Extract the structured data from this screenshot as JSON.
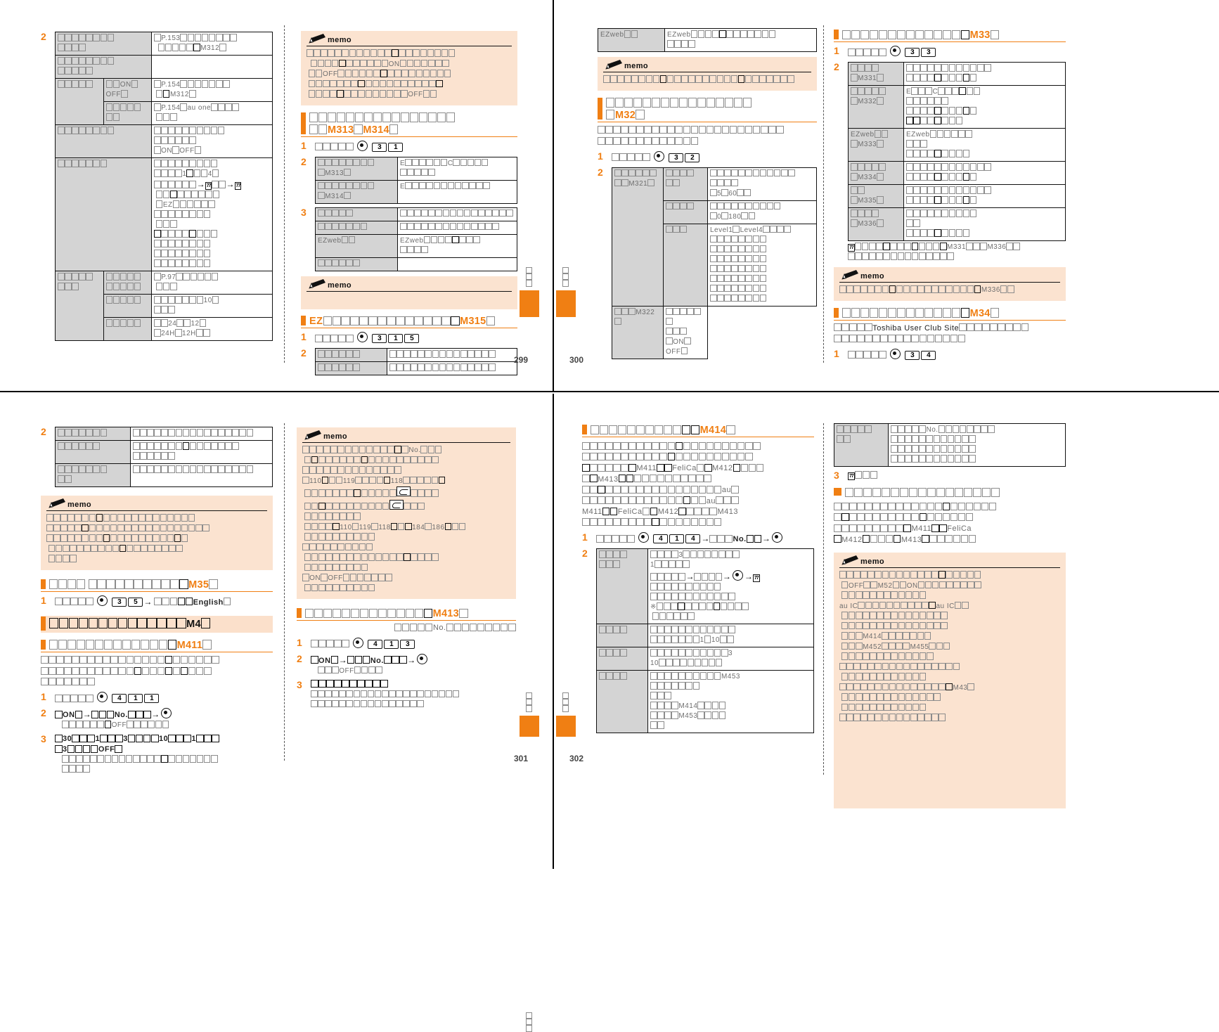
{
  "document": {
    "kind": "japanese-mobile-phone-manual-spread",
    "brand_text": [
      "au",
      "EZweb",
      "au one",
      "FeliCa",
      "Toshiba User Club Site",
      "English",
      "memo",
      "ON",
      "OFF",
      "No.",
      "Level1",
      "Level4"
    ],
    "accent_color": "#F07F13",
    "memo_bg": "#FBE3D0",
    "table_header_bg": "#D4D4D4",
    "note": "CJK glyphs render as empty boxes (tofu) in the source screenshot"
  },
  "pages": [
    {
      "number": "299",
      "position": "top-left-spread-right-column"
    },
    {
      "number": "300",
      "position": "top-right-spread-left-column"
    },
    {
      "number": "301",
      "position": "bottom-left-spread-right-column"
    },
    {
      "number": "302",
      "position": "bottom-right-spread-left-column"
    }
  ],
  "p299": {
    "left_table": {
      "step_number": "2",
      "rows": [
        {
          "c1": {
            "tofu": 8,
            "tofu2": 4
          },
          "c2": null,
          "c3_lat": "P.153",
          "c3_lat2": "M312",
          "c3_tofu": 13
        },
        {
          "c1": {
            "tofu": 9,
            "tofu2": 5
          },
          "c2": null,
          "c3_tofu": 0
        },
        {
          "c1": {
            "tofu": 6
          },
          "c2": {
            "tofu": 2,
            "lat": "ON",
            "lat2": "OFF",
            "tofu2": 1
          },
          "c3_lat": "P.154",
          "c3_lat2": "M312",
          "c3_tofu": 12
        },
        {
          "c1": null,
          "c2": {
            "tofu": 5,
            "tofu2": 2
          },
          "c3_lat": "P.154",
          "c3_lat2": "au one",
          "c3_tofu": 11
        },
        {
          "c1": {
            "tofu": 8
          },
          "c2": null,
          "c3_tofu": 14,
          "c3_lat": "ON",
          "c3_lat2": "OFF"
        },
        {
          "c1": {
            "tofu": 7
          },
          "c2": null,
          "c3_tofu": 13,
          "c3_lat": "1",
          "c3_lat2": "4",
          "c3_lat3": "EZ"
        },
        {
          "c1": {
            "tofu": 5,
            "tofu2": 3
          },
          "c2": {
            "tofu": 5,
            "tofu2": 5
          },
          "c3_lat": "P.97",
          "c3_tofu": 13
        },
        {
          "c1": null,
          "c2": {
            "tofu": 5
          },
          "c3_lat": "10",
          "c3_tofu": 12
        },
        {
          "c1": null,
          "c2": {
            "tofu": 5
          },
          "c3_lat": "24",
          "c3_lat2": "12",
          "c3_lat3": "24H",
          "c3_lat4": "12H",
          "c3_tofu": 6
        }
      ]
    },
    "memo1": {
      "label": "memo",
      "lines": [
        "ON",
        "OFF",
        "OFF"
      ]
    },
    "heading1": {
      "code": "M313",
      "code2": "M314"
    },
    "step1": {
      "no": "1",
      "keys": [
        "dot",
        "3",
        "1"
      ]
    },
    "table1": {
      "no": "2",
      "rows": [
        {
          "label_code": "M313",
          "desc_lat": "E",
          "desc_lat2": "C"
        },
        {
          "label_code": "M314",
          "desc_lat": "E"
        }
      ]
    },
    "table2": {
      "no": "3",
      "rows": [
        {
          "label_tofu": 5,
          "desc_tofu": 16
        },
        {
          "label_tofu": 7,
          "desc_tofu": 14
        },
        {
          "label_lat": "EZweb",
          "desc_lat": "EZweb"
        },
        {
          "label_tofu": 6,
          "desc_tofu": 0
        }
      ]
    },
    "memo2": {
      "label": "memo"
    },
    "heading2": {
      "prefix_lat": "EZ",
      "code": "M315"
    },
    "step2": {
      "no": "1",
      "keys": [
        "dot",
        "3",
        "1",
        "5"
      ]
    },
    "table3": {
      "no": "2",
      "rows": [
        {
          "label_tofu": 6,
          "desc_tofu": 18
        },
        {
          "label_tofu": 6,
          "desc_tofu": 18
        }
      ]
    },
    "sidetab_label_tofu": 3
  },
  "p300": {
    "top_table": {
      "label_lat": "EZweb",
      "desc_lat": "EZweb"
    },
    "memo1": {
      "label": "memo"
    },
    "heading1": {
      "code": "M32"
    },
    "intro_tofu": 38,
    "step1": {
      "no": "1",
      "keys": [
        "dot",
        "3",
        "2"
      ]
    },
    "table1": {
      "no": "2",
      "rows": [
        {
          "c1_code": "M321",
          "c2_tofu": 4,
          "c3_lat": "5",
          "c3_lat2": "60"
        },
        {
          "c1_code": null,
          "c2_tofu": 4,
          "c3_lat": "0",
          "c3_lat2": "180"
        },
        {
          "c1_code": null,
          "c2_tofu": 2,
          "c3_lat": "Level1",
          "c3_lat2": "Level4"
        },
        {
          "c1_code": "M322",
          "c2_tofu": 0,
          "c3_lat": "ON",
          "c3_lat2": "OFF"
        }
      ]
    },
    "sidetab_label_tofu": 3
  },
  "p300r": {
    "heading1": {
      "code": "M33"
    },
    "step1": {
      "no": "1",
      "keys": [
        "dot",
        "3",
        "3"
      ]
    },
    "table1": {
      "no": "2",
      "rows": [
        {
          "code": "M331",
          "desc_lat": null
        },
        {
          "code": "M332",
          "desc_lat": "E",
          "desc_lat2": "C"
        },
        {
          "code": "M333",
          "label_lat": "EZweb",
          "desc_lat": "EZweb"
        },
        {
          "code": "M334",
          "desc_lat": null
        },
        {
          "code": "M335",
          "desc_lat": null
        },
        {
          "code": "M336",
          "desc_lat": null
        }
      ],
      "footnote": {
        "icon": "page-ref",
        "lat": "M331",
        "lat2": "M336"
      }
    },
    "memo1": {
      "label": "memo",
      "lat": "M336"
    },
    "heading2": {
      "code": "M34"
    },
    "body_lat": "Toshiba User Club Site",
    "step2": {
      "no": "1",
      "keys": [
        "dot",
        "3",
        "4"
      ]
    }
  },
  "p301": {
    "table_top": {
      "no": "2",
      "rows": [
        {
          "label_tofu": 7,
          "desc_tofu": 17
        },
        {
          "label_tofu": 6,
          "desc_tofu": 20
        },
        {
          "label_tofu": 7,
          "label_tofu2": 2,
          "desc_tofu": 21
        }
      ]
    },
    "memo1": {
      "label": "memo"
    },
    "heading1": {
      "code": "M35"
    },
    "step1": {
      "no": "1",
      "keys": [
        "dot",
        "3",
        "5"
      ],
      "arrow": "→",
      "lat": "English"
    },
    "heading_band": {
      "code": "M4"
    },
    "heading2": {
      "code": "M411"
    },
    "step2": {
      "no": "1",
      "keys": [
        "dot",
        "4",
        "1",
        "1"
      ]
    },
    "step3": {
      "no": "2",
      "lat_on": "ON",
      "arrow": "→",
      "lat_no": "No.",
      "arrow2": "→",
      "key": "dot",
      "sub_lat": "OFF"
    },
    "step4": {
      "no": "3",
      "lat": [
        "30",
        "1",
        "3",
        "10",
        "1",
        "3",
        "OFF"
      ]
    }
  },
  "p301r": {
    "memo1": {
      "label": "memo",
      "lat": [
        "No.",
        "110",
        "119",
        "118",
        "110",
        "119",
        "118",
        "184",
        "186",
        "ON",
        "OFF"
      ]
    },
    "heading1": {
      "code": "M413",
      "sub_lat": "No."
    },
    "step1": {
      "no": "1",
      "keys": [
        "dot",
        "4",
        "1",
        "3"
      ]
    },
    "step2": {
      "no": "2",
      "lat_on": "ON",
      "arrow": "→",
      "lat_no": "No.",
      "arrow2": "→",
      "key": "dot",
      "sub_lat": "OFF"
    },
    "step3": {
      "no": "3"
    }
  },
  "p302": {
    "heading1": {
      "code": "M414"
    },
    "body_lat": [
      "M411",
      "FeliCa",
      "M412",
      "M413",
      "au",
      "au",
      "M411",
      "FeliCa",
      "M412",
      "M413"
    ],
    "step1": {
      "no": "1",
      "keys": [
        "dot",
        "4",
        "1",
        "4"
      ],
      "arrow": "→",
      "lat_no": "No.",
      "arrow2": "→",
      "key2": "dot"
    },
    "table1": {
      "no": "2",
      "rows": [
        {
          "label_tofu": 4,
          "label_tofu2": 3,
          "lat": "3",
          "lat2": "1",
          "lat3": "※"
        },
        {
          "label_tofu": 4,
          "lat": "1",
          "lat2": "10"
        },
        {
          "label_tofu": 4,
          "lat": "3",
          "lat2": "10"
        },
        {
          "label_tofu": 4,
          "lat": "M453",
          "lat2": "M414",
          "lat3": "M453"
        }
      ]
    }
  },
  "p302r": {
    "table_top": {
      "label_tofu": 5,
      "label_tofu2": 2,
      "lat": "No."
    },
    "step3": {
      "no": "3",
      "icon": "page-ref"
    },
    "heading_sq": {
      "tofu": 17
    },
    "body_lat": [
      "M411",
      "FeliCa",
      "M412",
      "M413"
    ],
    "memo1": {
      "label": "memo",
      "lat": [
        "OFF",
        "M52",
        "ON",
        "au IC",
        "au IC",
        "M414",
        "M452",
        "M455",
        "M43"
      ]
    }
  }
}
